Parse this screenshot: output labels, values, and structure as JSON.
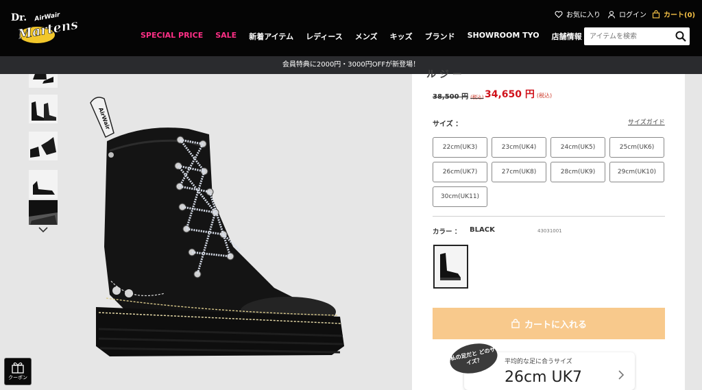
{
  "brand": {
    "logo_top": "Dr.",
    "logo_main": "Martens",
    "logo_tag": "AirWair"
  },
  "header": {
    "favorites_label": "お気に入り",
    "login_label": "ログイン",
    "cart_label": "カート(0)"
  },
  "nav": {
    "items": [
      "SPECIAL PRICE",
      "SALE",
      "新着アイテム",
      "レディース",
      "メンズ",
      "キッズ",
      "ブランド",
      "SHOWROOM TYO",
      "店舗情報"
    ]
  },
  "search": {
    "placeholder": "アイテムを検索"
  },
  "announcement": "会員特典に2000円・3000円OFFが新登場！",
  "product": {
    "title_partial": "ル ジ ー",
    "original_price": "38,500 円",
    "original_tax": "(税込)",
    "sale_price": "34,650 円",
    "sale_tax": "(税込)",
    "size_label": "サイズ ：",
    "size_guide": "サイズガイド",
    "sizes": [
      "22cm(UK3)",
      "23cm(UK4)",
      "24cm(UK5)",
      "25cm(UK6)",
      "26cm(UK7)",
      "27cm(UK8)",
      "28cm(UK9)",
      "29cm(UK10)",
      "30cm(UK11)"
    ],
    "color_label": "カラー ：",
    "color_name": "BLACK",
    "color_code": "43031001",
    "add_to_cart": "カートに入れる"
  },
  "fit": {
    "bubble": "私の足だと どのサイズ？",
    "subtitle": "平均的な足に合うサイズ",
    "size": "26cm UK7"
  },
  "coupon": {
    "label": "クーポン"
  },
  "colors": {
    "header_bg": "#050505",
    "pink": "#ff2f86",
    "sale_red": "#d0121b",
    "cart_yellow": "#f5c146",
    "cart_button": "#f8c98c"
  }
}
